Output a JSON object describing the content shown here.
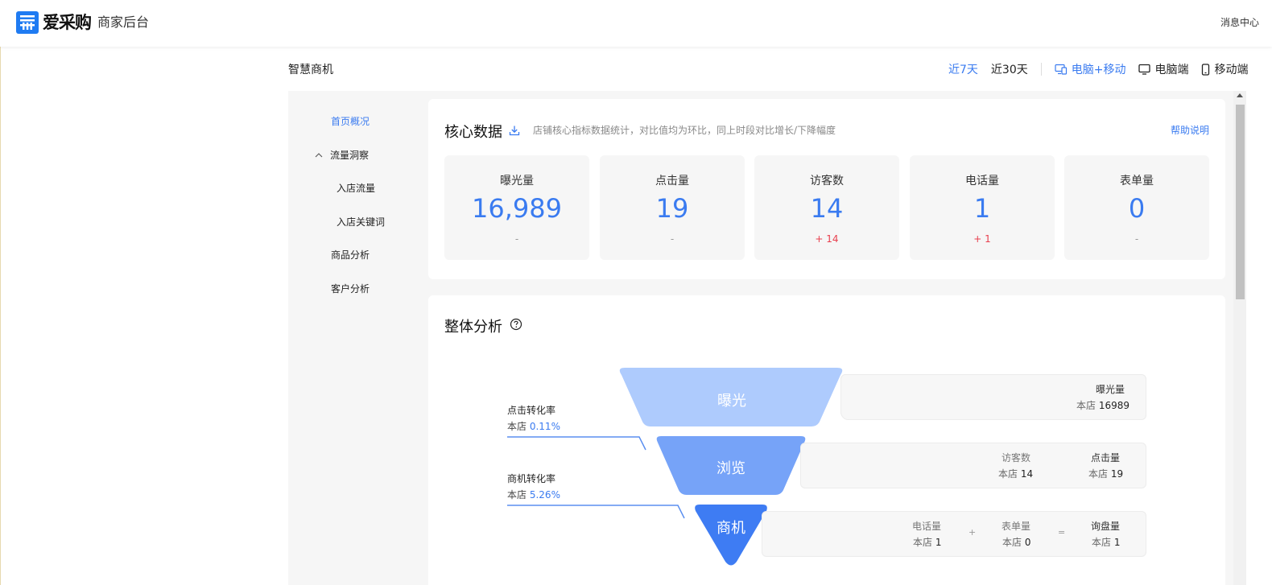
{
  "header": {
    "logo_text": "爱采购",
    "subtitle": "商家后台",
    "message_center": "消息中心"
  },
  "page": {
    "title": "智慧商机"
  },
  "filters": {
    "period_7": "近7天",
    "period_30": "近30天",
    "device_all": "电脑+移动",
    "device_pc": "电脑端",
    "device_mobile": "移动端",
    "active_color": "#3a7bf0"
  },
  "sidebar": {
    "items": [
      {
        "label": "首页概况"
      },
      {
        "label": "流量洞察"
      },
      {
        "label": "入店流量"
      },
      {
        "label": "入店关键词"
      },
      {
        "label": "商品分析"
      },
      {
        "label": "客户分析"
      }
    ]
  },
  "core": {
    "title": "核心数据",
    "description": "店铺核心指标数据统计，对比值均为环比，同上时段对比增长/下降幅度",
    "help": "帮助说明",
    "metrics": [
      {
        "label": "曝光量",
        "value": "16,989",
        "delta": "-"
      },
      {
        "label": "点击量",
        "value": "19",
        "delta": "-"
      },
      {
        "label": "访客数",
        "value": "14",
        "delta": "+ 14"
      },
      {
        "label": "电话量",
        "value": "1",
        "delta": "+ 1"
      },
      {
        "label": "表单量",
        "value": "0",
        "delta": "-"
      }
    ]
  },
  "overall": {
    "title": "整体分析",
    "funnel": {
      "stage1": "曝光",
      "stage2": "浏览",
      "stage3": "商机"
    },
    "conversions": {
      "click_label": "点击转化率",
      "click_prefix": "本店",
      "click_value": "0.11%",
      "biz_label": "商机转化率",
      "biz_prefix": "本店",
      "biz_value": "5.26%"
    },
    "stats": {
      "exposure_head": "曝光量",
      "exposure_prefix": "本店",
      "exposure_value": "16989",
      "visitor_head": "访客数",
      "visitor_prefix": "本店",
      "visitor_value": "14",
      "click_head": "点击量",
      "click_prefix": "本店",
      "click_value": "19",
      "phone_head": "电话量",
      "phone_prefix": "本店",
      "phone_value": "1",
      "plus": "+",
      "form_head": "表单量",
      "form_prefix": "本店",
      "form_value": "0",
      "equals": "=",
      "inquiry_head": "询盘量",
      "inquiry_prefix": "本店",
      "inquiry_value": "1"
    }
  }
}
